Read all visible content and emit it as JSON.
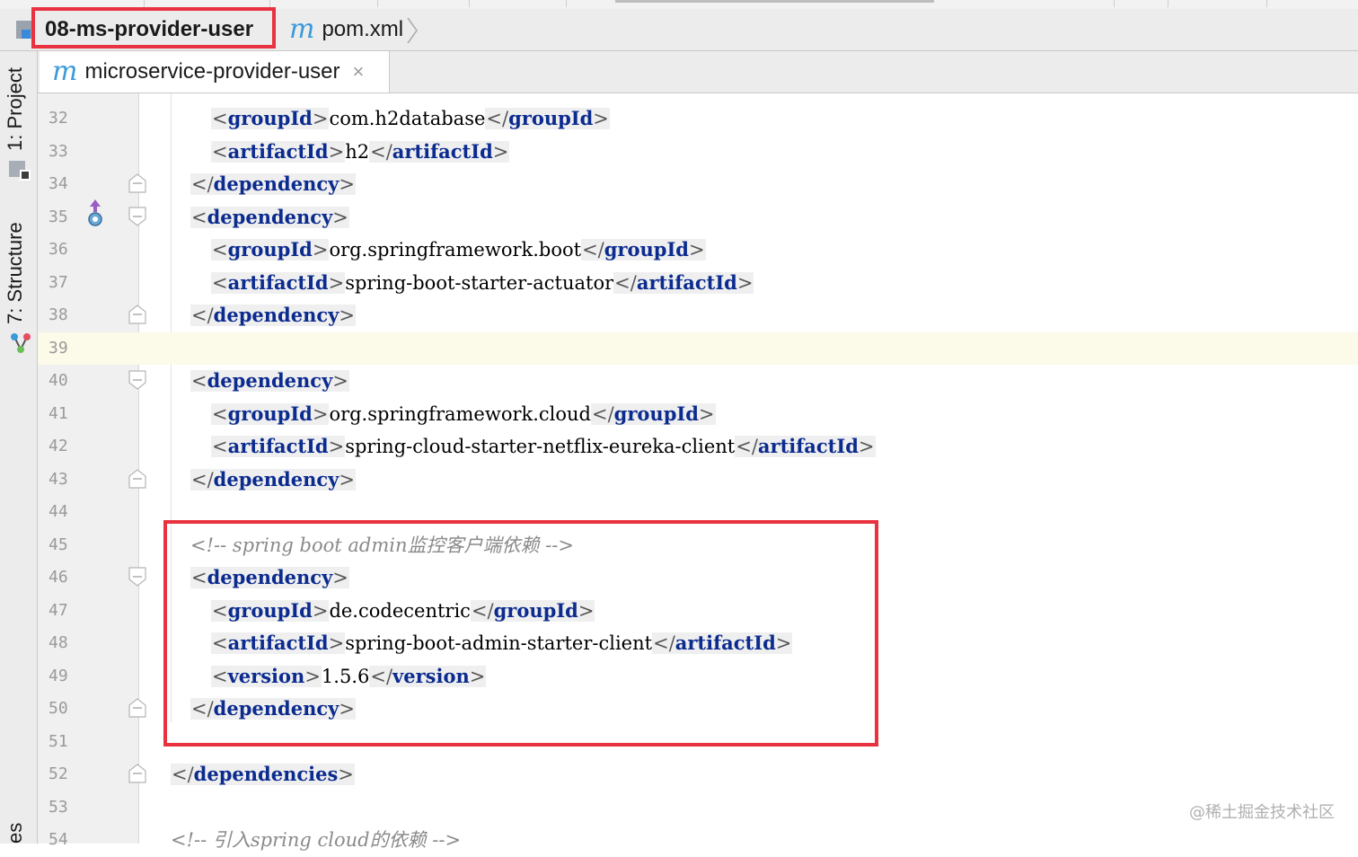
{
  "breadcrumb": {
    "project": "08-ms-provider-user",
    "file_icon": "m",
    "file": "pom.xml"
  },
  "tab": {
    "icon": "m",
    "label": "microservice-provider-user",
    "close": "×"
  },
  "tool_windows": {
    "project": "1: Project",
    "structure": "7: Structure",
    "bottom": "es"
  },
  "editor": {
    "current_line": 39,
    "lines": [
      {
        "n": "32",
        "indent": 2,
        "parts": [
          [
            "tag",
            "groupId"
          ],
          [
            "text",
            "com.h2database"
          ],
          [
            "ctag",
            "groupId"
          ]
        ]
      },
      {
        "n": "33",
        "indent": 2,
        "parts": [
          [
            "tag",
            "artifactId"
          ],
          [
            "text",
            "h2"
          ],
          [
            "ctag",
            "artifactId"
          ]
        ]
      },
      {
        "n": "34",
        "indent": 1,
        "fold": "end",
        "parts": [
          [
            "ctag",
            "dependency"
          ]
        ]
      },
      {
        "n": "35",
        "indent": 1,
        "fold": "start",
        "marker": true,
        "parts": [
          [
            "tag",
            "dependency"
          ]
        ]
      },
      {
        "n": "36",
        "indent": 2,
        "parts": [
          [
            "tag",
            "groupId"
          ],
          [
            "text",
            "org.springframework.boot"
          ],
          [
            "ctag",
            "groupId"
          ]
        ]
      },
      {
        "n": "37",
        "indent": 2,
        "parts": [
          [
            "tag",
            "artifactId"
          ],
          [
            "text",
            "spring-boot-starter-actuator"
          ],
          [
            "ctag",
            "artifactId"
          ]
        ]
      },
      {
        "n": "38",
        "indent": 1,
        "fold": "end",
        "parts": [
          [
            "ctag",
            "dependency"
          ]
        ]
      },
      {
        "n": "39",
        "indent": 0,
        "parts": []
      },
      {
        "n": "40",
        "indent": 1,
        "fold": "start",
        "parts": [
          [
            "tag",
            "dependency"
          ]
        ]
      },
      {
        "n": "41",
        "indent": 2,
        "parts": [
          [
            "tag",
            "groupId"
          ],
          [
            "text",
            "org.springframework.cloud"
          ],
          [
            "ctag",
            "groupId"
          ]
        ]
      },
      {
        "n": "42",
        "indent": 2,
        "parts": [
          [
            "tag",
            "artifactId"
          ],
          [
            "text",
            "spring-cloud-starter-netflix-eureka-client"
          ],
          [
            "ctag",
            "artifactId"
          ]
        ]
      },
      {
        "n": "43",
        "indent": 1,
        "fold": "end",
        "parts": [
          [
            "ctag",
            "dependency"
          ]
        ]
      },
      {
        "n": "44",
        "indent": 0,
        "parts": []
      },
      {
        "n": "45",
        "indent": 1,
        "parts": [
          [
            "comment",
            "<!-- spring boot admin监控客户端依赖 -->"
          ]
        ]
      },
      {
        "n": "46",
        "indent": 1,
        "fold": "start",
        "parts": [
          [
            "tag",
            "dependency"
          ]
        ]
      },
      {
        "n": "47",
        "indent": 2,
        "parts": [
          [
            "tag",
            "groupId"
          ],
          [
            "text",
            "de.codecentric"
          ],
          [
            "ctag",
            "groupId"
          ]
        ]
      },
      {
        "n": "48",
        "indent": 2,
        "parts": [
          [
            "tag",
            "artifactId"
          ],
          [
            "text",
            "spring-boot-admin-starter-client"
          ],
          [
            "ctag",
            "artifactId"
          ]
        ]
      },
      {
        "n": "49",
        "indent": 2,
        "parts": [
          [
            "tag",
            "version"
          ],
          [
            "text",
            "1.5.6"
          ],
          [
            "ctag",
            "version"
          ]
        ]
      },
      {
        "n": "50",
        "indent": 1,
        "fold": "end",
        "parts": [
          [
            "ctag",
            "dependency"
          ]
        ]
      },
      {
        "n": "51",
        "indent": 0,
        "parts": []
      },
      {
        "n": "52",
        "indent": 0,
        "fold": "end",
        "parts": [
          [
            "ctag",
            "dependencies"
          ]
        ]
      },
      {
        "n": "53",
        "indent": 0,
        "parts": []
      },
      {
        "n": "54",
        "indent": 0,
        "parts": [
          [
            "comment",
            "<!-- 引入spring cloud的依赖 -->"
          ]
        ]
      }
    ]
  },
  "watermark": "@稀土掘金技术社区",
  "colors": {
    "highlight": "#e8323f",
    "tag_name": "#0b2b8f",
    "comment": "#8a8a8a",
    "current_line": "#fcfae8",
    "maven_icon": "#3a9ad9"
  }
}
